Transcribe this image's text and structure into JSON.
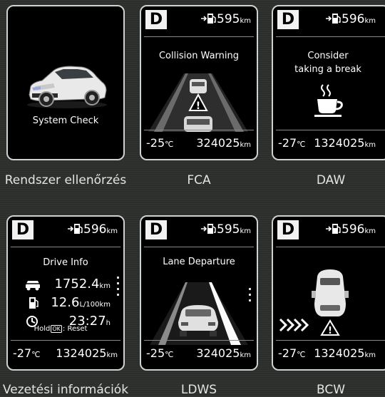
{
  "colors": {
    "background": "#2c2e2c",
    "screen": "#000000",
    "frame": "#cfd2d2",
    "text": "#ffffff"
  },
  "panels": {
    "system_check": {
      "message": "System Check",
      "caption": "Rendszer ellenőrzés"
    },
    "fca": {
      "gear": "D",
      "range_value": "595",
      "range_unit": "km",
      "title": "Collision Warning",
      "temp_value": "-25",
      "temp_unit": "℃",
      "odo_value": "324025",
      "odo_unit": "km",
      "caption": "FCA"
    },
    "daw": {
      "gear": "D",
      "range_value": "596",
      "range_unit": "km",
      "title_line1": "Consider",
      "title_line2": "taking a break",
      "temp_value": "-27",
      "temp_unit": "℃",
      "odo_value": "1324025",
      "odo_unit": "km",
      "caption": "DAW"
    },
    "drive_info": {
      "gear": "D",
      "range_value": "596",
      "range_unit": "km",
      "title": "Drive Info",
      "distance_value": "1752.4",
      "distance_unit": "km",
      "consumption_value": "12.6",
      "consumption_unit": "L/100km",
      "time_value": "23:27",
      "time_unit": "h",
      "hold_prefix": "Hold",
      "hold_key": "OK",
      "hold_suffix": ": Reset",
      "temp_value": "-27",
      "temp_unit": "℃",
      "odo_value": "1324025",
      "odo_unit": "km",
      "caption": "Vezetési információk"
    },
    "ldws": {
      "gear": "D",
      "range_value": "595",
      "range_unit": "km",
      "title": "Lane Departure",
      "temp_value": "-25",
      "temp_unit": "℃",
      "odo_value": "324025",
      "odo_unit": "km",
      "caption": "LDWS"
    },
    "bcw": {
      "gear": "D",
      "range_value": "596",
      "range_unit": "km",
      "temp_value": "-27",
      "temp_unit": "℃",
      "odo_value": "1324025",
      "odo_unit": "km",
      "caption": "BCW"
    }
  }
}
